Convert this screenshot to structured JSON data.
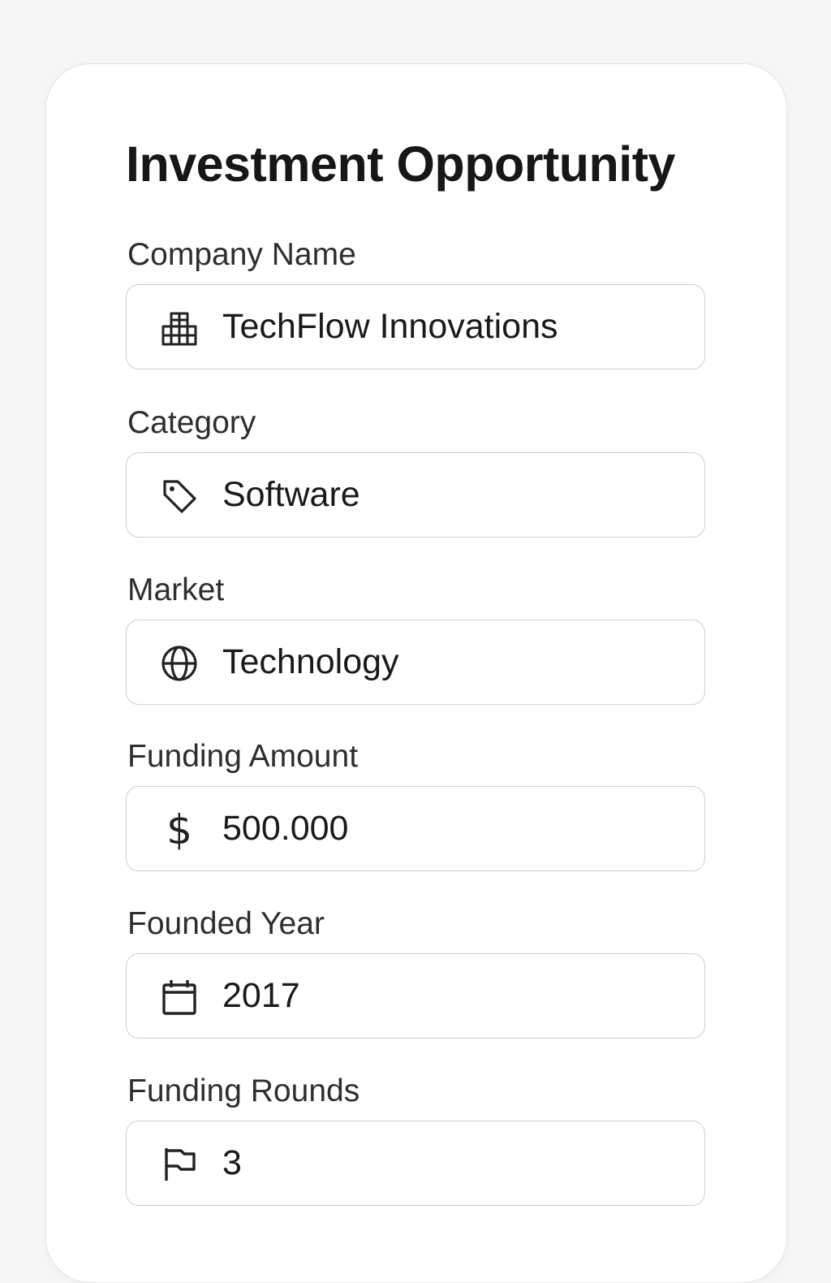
{
  "form": {
    "title": "Investment Opportunity",
    "fields": [
      {
        "label": "Company Name",
        "value": "TechFlow Innovations",
        "icon": "building-icon"
      },
      {
        "label": "Category",
        "value": "Software",
        "icon": "tag-icon"
      },
      {
        "label": "Market",
        "value": "Technology",
        "icon": "globe-icon"
      },
      {
        "label": "Funding Amount",
        "value": "500.000",
        "icon": "dollar-icon",
        "icon_glyph": "$"
      },
      {
        "label": "Founded Year",
        "value": "2017",
        "icon": "calendar-icon"
      },
      {
        "label": "Funding Rounds",
        "value": "3",
        "icon": "flag-icon"
      }
    ]
  },
  "colors": {
    "background": "#f6f6f6",
    "card": "#ffffff",
    "border": "#cfcfcf",
    "text": "#1c1c1c"
  }
}
